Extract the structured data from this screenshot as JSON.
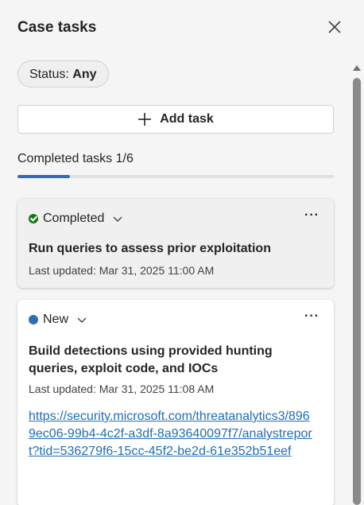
{
  "panel": {
    "title": "Case tasks",
    "close_icon": "close-icon"
  },
  "filter": {
    "label": "Status:",
    "value": "Any"
  },
  "add_task": {
    "label": "Add task",
    "icon": "plus-icon"
  },
  "progress": {
    "label": "Completed tasks 1/6",
    "fraction": 0.1667,
    "color": "#2f6db5"
  },
  "tasks": [
    {
      "status": "Completed",
      "status_color": "#107c10",
      "title": "Run queries to assess prior exploitation",
      "updated": "Last updated: Mar 31, 2025 11:00 AM",
      "more": "···"
    },
    {
      "status": "New",
      "status_color": "#2f6db5",
      "title": "Build detections using provided hunting queries, exploit code, and IOCs",
      "updated": "Last updated: Mar 31, 2025 11:08 AM",
      "link": "https://security.microsoft.com/threatanalytics3/8969ec06-99b4-4c2f-a3df-8a93640097f7/analystreport?tid=536279f6-15cc-45f2-be2d-61e352b51eef",
      "more": "···"
    }
  ]
}
